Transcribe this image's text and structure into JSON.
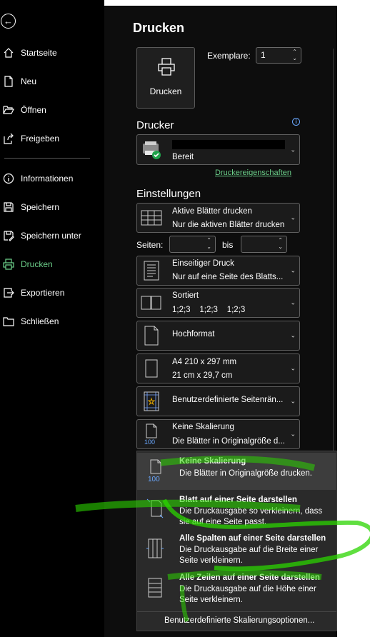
{
  "sidebar": {
    "items": [
      {
        "label": "Startseite",
        "icon": "home-icon"
      },
      {
        "label": "Neu",
        "icon": "new-file-icon"
      },
      {
        "label": "Öffnen",
        "icon": "folder-open-icon"
      },
      {
        "label": "Freigeben",
        "icon": "share-icon"
      },
      {
        "label": "Informationen",
        "icon": "info-icon"
      },
      {
        "label": "Speichern",
        "icon": "save-icon"
      },
      {
        "label": "Speichern unter",
        "icon": "save-as-icon"
      },
      {
        "label": "Drucken",
        "icon": "printer-icon",
        "active": true
      },
      {
        "label": "Exportieren",
        "icon": "export-icon"
      },
      {
        "label": "Schließen",
        "icon": "close-file-icon"
      }
    ]
  },
  "main": {
    "title": "Drucken",
    "print_button": "Drucken",
    "copies_label": "Exemplare:",
    "copies_value": "1",
    "printer_section": "Drucker",
    "printer_status": "Bereit",
    "printer_properties": "Druckereigenschaften",
    "settings_section": "Einstellungen",
    "pages_label": "Seiten:",
    "pages_to_label": "bis",
    "settings": {
      "what": {
        "line1": "Aktive Blätter drucken",
        "line2": "Nur die aktiven Blätter drucken"
      },
      "sides": {
        "line1": "Einseitiger Druck",
        "line2": "Nur auf eine Seite des Blatts..."
      },
      "collate": {
        "line1": "Sortiert",
        "line2": "1;2;3    1;2;3    1;2;3"
      },
      "orientation": {
        "line1": "Hochformat"
      },
      "paper": {
        "line1": "A4 210 x 297 mm",
        "line2": "21 cm x 29,7 cm"
      },
      "margins": {
        "line1": "Benutzerdefinierte Seitenrän..."
      },
      "scaling": {
        "line1": "Keine Skalierung",
        "line2": "Die Blätter in Originalgröße d..."
      }
    }
  },
  "scaling_menu": {
    "options": [
      {
        "title": "Keine Skalierung",
        "desc": "Die Blätter in Originalgröße drucken."
      },
      {
        "title": "Blatt auf einer Seite darstellen",
        "desc": "Die Druckausgabe so verkleinern, dass sie auf eine Seite passt."
      },
      {
        "title": "Alle Spalten auf einer Seite darstellen",
        "desc": "Die Druckausgabe auf die Breite einer Seite verkleinern."
      },
      {
        "title": "Alle Zeilen auf einer Seite darstellen",
        "desc": "Die Druckausgabe auf die Höhe einer Seite verkleinern."
      }
    ],
    "custom": "Benutzerdefinierte Skalierungsoptionen..."
  },
  "colors": {
    "accent_green": "#6ccf8a",
    "scribble_green": "#2bd400",
    "info_blue": "#6aa8ff"
  }
}
